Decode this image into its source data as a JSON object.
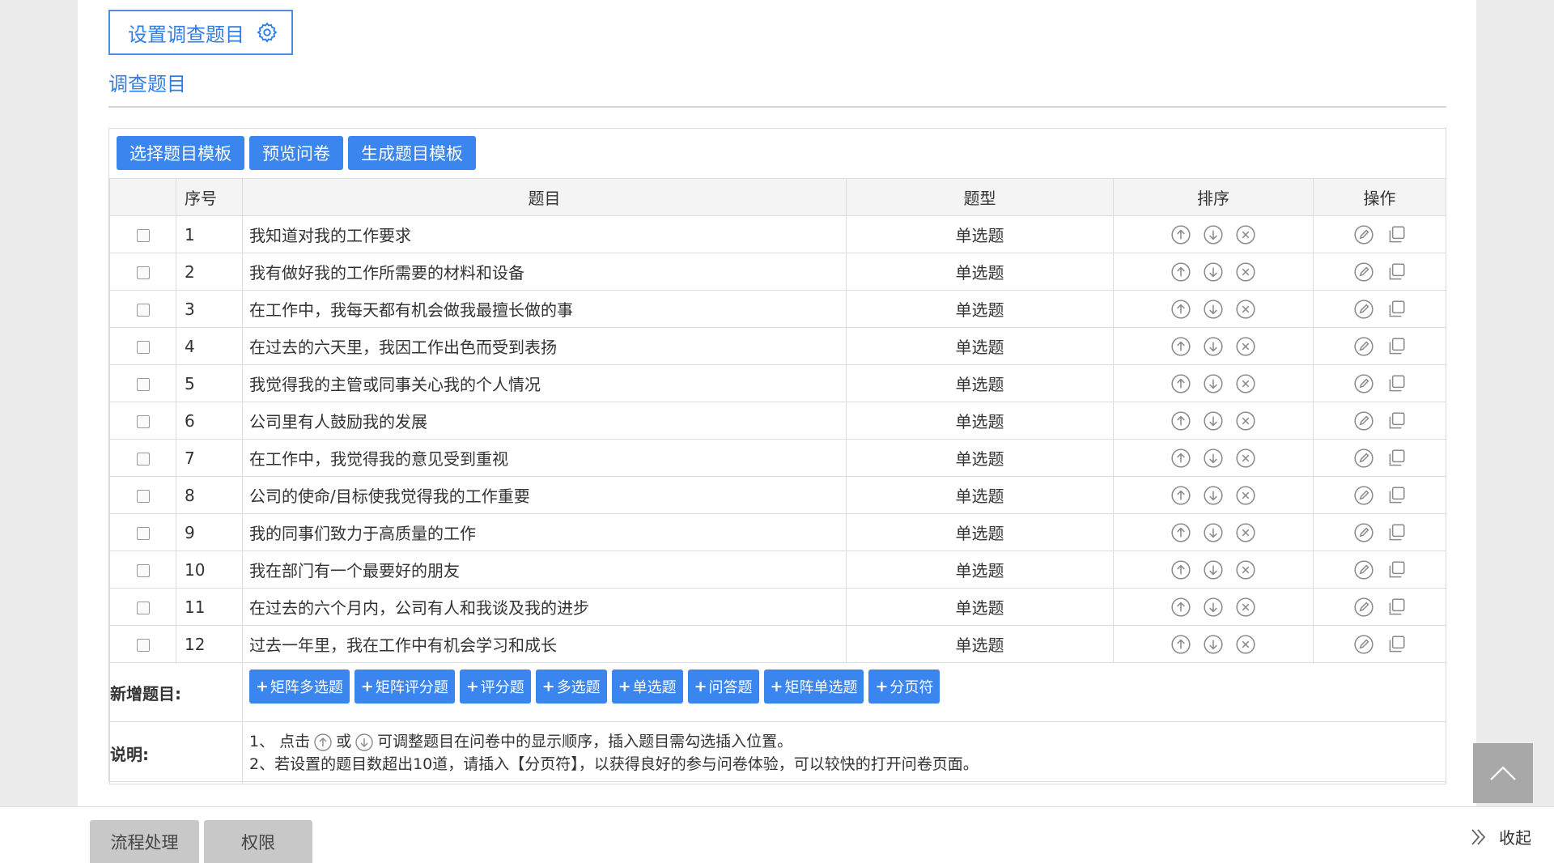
{
  "header": {
    "title_button_label": "设置调查题目",
    "section_title": "调查题目"
  },
  "toolbar": {
    "select_template_label": "选择题目模板",
    "preview_label": "预览问卷",
    "generate_template_label": "生成题目模板"
  },
  "table": {
    "headers": {
      "no": "序号",
      "question": "题目",
      "type": "题型",
      "sort": "排序",
      "ops": "操作"
    },
    "rows": [
      {
        "no": "1",
        "question": "我知道对我的工作要求",
        "type": "单选题"
      },
      {
        "no": "2",
        "question": "我有做好我的工作所需要的材料和设备",
        "type": "单选题"
      },
      {
        "no": "3",
        "question": "在工作中，我每天都有机会做我最擅长做的事",
        "type": "单选题"
      },
      {
        "no": "4",
        "question": "在过去的六天里，我因工作出色而受到表扬",
        "type": "单选题"
      },
      {
        "no": "5",
        "question": "我觉得我的主管或同事关心我的个人情况",
        "type": "单选题"
      },
      {
        "no": "6",
        "question": "公司里有人鼓励我的发展",
        "type": "单选题"
      },
      {
        "no": "7",
        "question": "在工作中，我觉得我的意见受到重视",
        "type": "单选题"
      },
      {
        "no": "8",
        "question": "公司的使命/目标使我觉得我的工作重要",
        "type": "单选题"
      },
      {
        "no": "9",
        "question": "我的同事们致力于高质量的工作",
        "type": "单选题"
      },
      {
        "no": "10",
        "question": "我在部门有一个最要好的朋友",
        "type": "单选题"
      },
      {
        "no": "11",
        "question": "在过去的六个月内，公司有人和我谈及我的进步",
        "type": "单选题"
      },
      {
        "no": "12",
        "question": "过去一年里，我在工作中有机会学习和成长",
        "type": "单选题"
      }
    ]
  },
  "add_section": {
    "label": "新增题目:",
    "buttons": [
      "矩阵多选题",
      "矩阵评分题",
      "评分题",
      "多选题",
      "单选题",
      "问答题",
      "矩阵单选题",
      "分页符"
    ]
  },
  "notes": {
    "label": "说明:",
    "line1_a": "1、 点击",
    "line1_or": "或",
    "line1_b": "可调整题目在问卷中的显示顺序，插入题目需勾选插入位置。",
    "line2": "2、若设置的题目数超出10道，请插入【分页符】，以获得良好的参与问卷体验，可以较快的打开问卷页面。"
  },
  "bottom": {
    "tab1": "流程处理",
    "tab2": "权限",
    "collapse_label": "收起"
  },
  "colors": {
    "accent": "#3a86ee",
    "title_text": "#2f7ee6",
    "icon_gray": "#8a8a8a"
  },
  "icons": {
    "title": "gear-icon",
    "sort": [
      "arrow-up-circle-icon",
      "arrow-down-circle-icon",
      "close-circle-icon"
    ],
    "ops": [
      "edit-icon",
      "copy-icon"
    ],
    "collapse": "double-chevron-right-icon",
    "backtop": "chevron-up-icon"
  }
}
